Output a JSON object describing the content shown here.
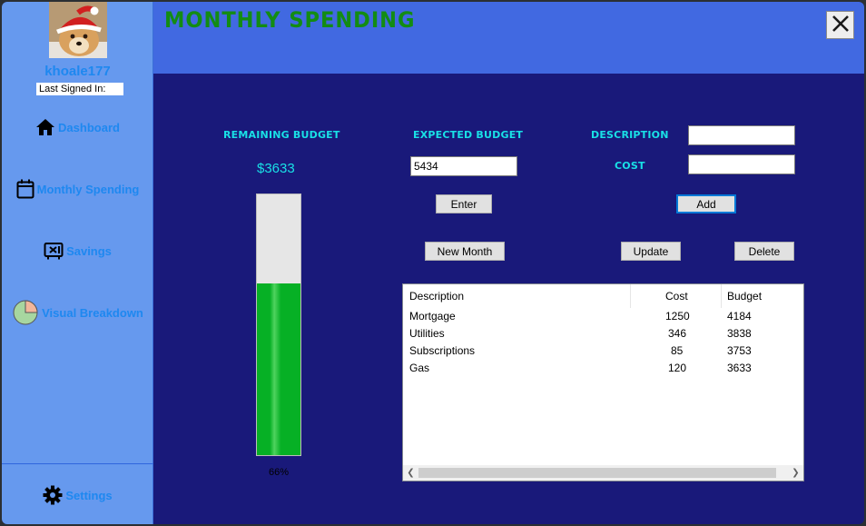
{
  "user": {
    "username": "khoale177",
    "last_signed_label": "Last Signed In:"
  },
  "nav": [
    {
      "label": "Dashboard",
      "icon": "home-icon"
    },
    {
      "label": "Monthly Spending",
      "icon": "calendar-icon"
    },
    {
      "label": "Savings",
      "icon": "safe-icon"
    },
    {
      "label": "Visual Breakdown",
      "icon": "pie-chart-icon"
    }
  ],
  "settings": {
    "label": "Settings",
    "icon": "gear-icon"
  },
  "header": {
    "title": "Monthly Spending",
    "close_icon": "close-icon"
  },
  "budget": {
    "remaining_label": "Remaining Budget",
    "remaining_value": "$3633",
    "progress_percent": 66,
    "progress_text": "66%",
    "expected_label": "Expected Budget",
    "expected_value": "5434"
  },
  "entry": {
    "description_label": "Description",
    "cost_label": "Cost",
    "description_value": "",
    "cost_value": ""
  },
  "buttons": {
    "enter": "Enter",
    "add": "Add",
    "new_month": "New Month",
    "update": "Update",
    "delete": "Delete"
  },
  "table": {
    "columns": [
      "Description",
      "Cost",
      "Budget"
    ],
    "rows": [
      [
        "Mortgage",
        "1250",
        "4184"
      ],
      [
        "Utilities",
        "346",
        "3838"
      ],
      [
        "Subscriptions",
        "85",
        "3753"
      ],
      [
        "Gas",
        "120",
        "3633"
      ]
    ]
  },
  "colors": {
    "sidebar": "#6699ee",
    "header": "#4169e1",
    "main": "#19197a",
    "accent_text": "#19e0e6",
    "title_green": "#138c13",
    "progress_green": "#06b025"
  }
}
